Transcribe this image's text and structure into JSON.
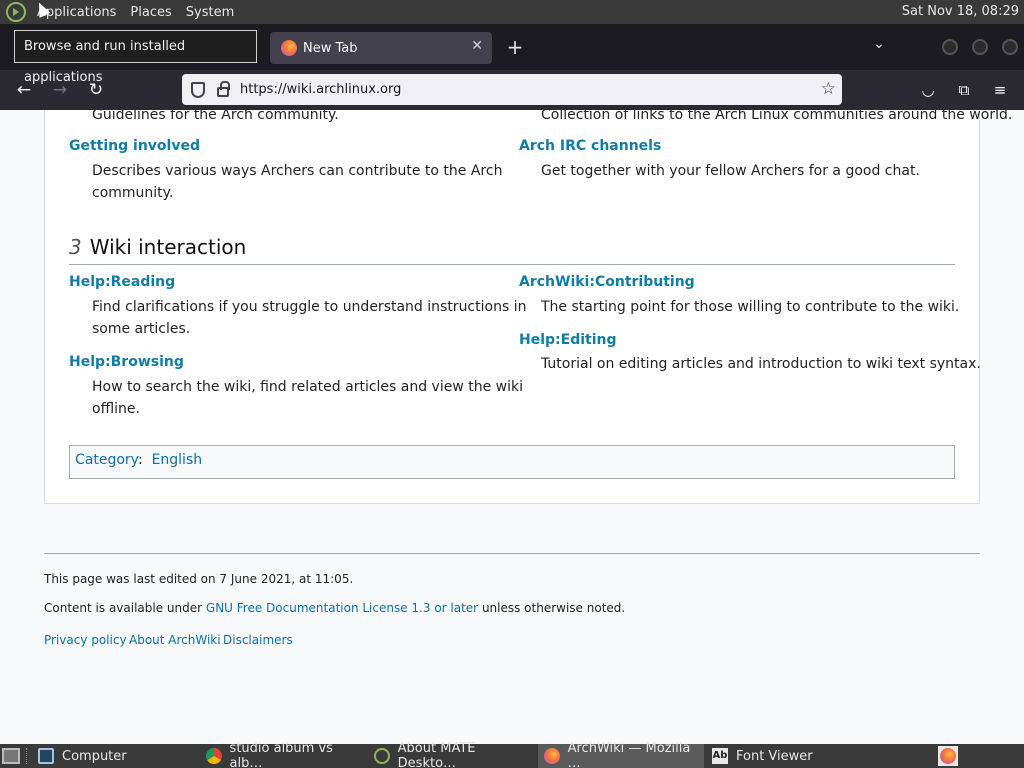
{
  "top_panel": {
    "menus": [
      "Applications",
      "Places",
      "System"
    ],
    "clock": "Sat Nov 18, 08:29"
  },
  "tooltip": "Browse and run installed applications",
  "browser": {
    "tab_title": "New Tab",
    "url": "https://wiki.archlinux.org"
  },
  "page": {
    "partial_left": "Guidelines for the Arch community.",
    "partial_right": "Collection of links to the Arch Linux communities around the world.",
    "getting_involved": {
      "title": "Getting involved",
      "desc_line1": "Describes various ways Archers can contribute to the Arch",
      "desc_line2": "community."
    },
    "irc": {
      "title": "Arch IRC channels",
      "desc": "Get together with your fellow Archers for a good chat."
    },
    "section": {
      "number": "3",
      "title": "Wiki interaction"
    },
    "help_reading": {
      "title": "Help:Reading",
      "desc_line1": "Find clarifications if you struggle to understand instructions in",
      "desc_line2": "some articles."
    },
    "contributing": {
      "title": "ArchWiki:Contributing",
      "desc": "The starting point for those willing to contribute to the wiki."
    },
    "help_editing": {
      "title": "Help:Editing",
      "desc": "Tutorial on editing articles and introduction to wiki text syntax."
    },
    "help_browsing": {
      "title": "Help:Browsing",
      "desc_line1": "How to search the wiki, find related articles and view the wiki",
      "desc_line2": "offline."
    },
    "category": {
      "label": "Category",
      "sep": ":",
      "value": "English"
    },
    "footer": {
      "last_edited": "This page was last edited on 7 June 2021, at 11:05.",
      "content_prefix": "Content is available under ",
      "license_link": "GNU Free Documentation License 1.3 or later",
      "content_suffix": " unless otherwise noted.",
      "links": [
        "Privacy policy",
        "About ArchWiki",
        "Disclaimers"
      ]
    }
  },
  "taskbar": {
    "items": [
      {
        "label": "Computer",
        "icon": "computer-icon"
      },
      {
        "label": "studio album vs alb…",
        "icon": "chrome-icon"
      },
      {
        "label": "About MATE Deskto…",
        "icon": "mate-icon"
      },
      {
        "label": "ArchWiki — Mozilla …",
        "icon": "firefox-icon"
      },
      {
        "label": "Font Viewer",
        "icon": "font-viewer-icon"
      }
    ]
  }
}
